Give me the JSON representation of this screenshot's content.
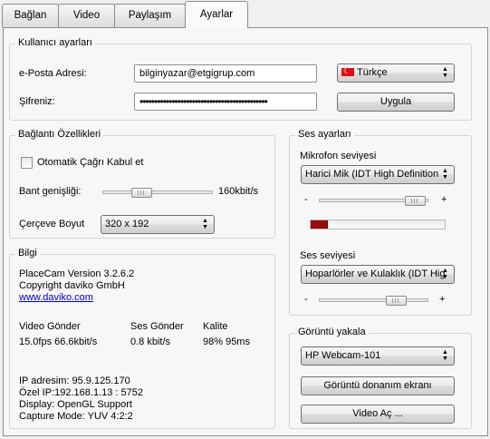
{
  "tabs": [
    {
      "label": "Bağlan"
    },
    {
      "label": "Video"
    },
    {
      "label": "Paylaşım"
    },
    {
      "label": "Ayarlar",
      "active": true
    }
  ],
  "user_settings": {
    "title": "Kullanıcı ayarları",
    "email_label": "e-Posta Adresi:",
    "email_value": "bilginyazar@etgigrup.com",
    "password_label": "Şifreniz:",
    "password_value": "••••••••••••••••••••••••••••••••••••••••••••",
    "language_value": "Türkçe",
    "apply_label": "Uygula"
  },
  "connection": {
    "title": "Bağlantı Özellikleri",
    "auto_accept_label": "Otomatik Çağrı Kabul et",
    "auto_accept_checked": false,
    "bandwidth_label": "Bant genişliği:",
    "bandwidth_value": "160kbit/s",
    "bandwidth_level": 0.39,
    "frame_size_label": "Çerçeve Boyut",
    "frame_size_value": "320 x 192"
  },
  "info": {
    "title": "Bilgi",
    "version": "PlaceCam Version 3.2.6.2",
    "copyright": "Copyright daviko GmbH",
    "website": "www.daviko.com",
    "video_send_label": "Video Gönder",
    "video_send_value": "15.0fps 66.6kbit/s",
    "audio_send_label": "Ses Gönder",
    "audio_send_value": "0.8 kbit/s",
    "quality_label": "Kalite",
    "quality_value": "98% 95ms",
    "ip_address": "IP adresim: 95.9.125.170",
    "private_ip": "Özel IP:192.168.1.13 : 5752",
    "display": "Display: OpenGL Support",
    "capture_mode": "Capture Mode: YUV 4:2:2"
  },
  "sound": {
    "title": "Ses ayarları",
    "mic_level_label": "Mikrofon seviyesi",
    "mic_device": "Harici Mik (IDT High Definition",
    "mic_slider_level": 0.93,
    "mic_meter_level": 0.12,
    "minus_label": "-",
    "plus_label": "+",
    "volume_label": "Ses seviyesi",
    "speaker_device": "Hoparlörler ve Kulaklık (IDT Hig",
    "volume_slider_level": 0.7
  },
  "capture": {
    "title": "Görüntü yakala",
    "camera_device": "HP Webcam-101",
    "hardware_screen_label": "Görüntü donanım ekranı",
    "open_video_label": "Video Aç ..."
  },
  "colors": {
    "meter_fill": "#9c0a0a",
    "link": "#0000cc",
    "flag_red": "#e30a17"
  }
}
